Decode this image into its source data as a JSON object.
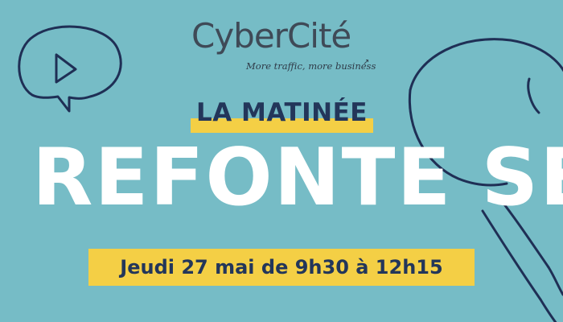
{
  "logo": {
    "wordmark": "CyberCité",
    "tagline": "More traffic, more business",
    "arrow_glyph": "↗"
  },
  "event": {
    "kicker": "LA MATINÉE",
    "headline": "REFONTE SEO",
    "date": "Jeudi 27 mai de 9h30 à 12h15"
  },
  "decorations": {
    "left": "play-speech-bubble-icon",
    "right": "magnifying-glass-icon"
  },
  "colors": {
    "background": "#76bcc6",
    "highlight_yellow": "#f4cf45",
    "navy_text": "#23365a",
    "logo_gray": "#3f4a57",
    "headline_white": "#ffffff"
  }
}
